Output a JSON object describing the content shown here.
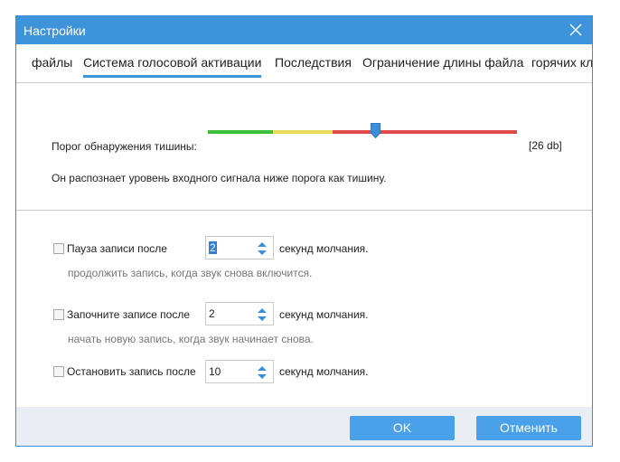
{
  "window": {
    "title": "Настройки"
  },
  "tabs": [
    {
      "label": "файлы"
    },
    {
      "label": "Система голосовой активации"
    },
    {
      "label": "Последствия"
    },
    {
      "label": "Ограничение длины файла"
    },
    {
      "label": "горячих кл"
    }
  ],
  "silence": {
    "label": "Порог обнаружения тишины:",
    "value_text": "[26 db]",
    "description": "Он распознает уровень входного сигнала ниже порога как тишину."
  },
  "options": [
    {
      "label": "Пауза записи после",
      "value": "2",
      "suffix": "секунд молчания.",
      "hint": "продолжить запись, когда звук снова включится."
    },
    {
      "label": "Започните записе после",
      "value": "2",
      "suffix": "секунд молчания.",
      "hint": "начать новую запись, когда звук начинает снова."
    },
    {
      "label": "Остановить запись после",
      "value": "10",
      "suffix": "секунд молчания."
    }
  ],
  "footer": {
    "ok": "OK",
    "cancel": "Отменить"
  },
  "colors": {
    "accent": "#3d94db",
    "green": "#3cc03c",
    "yellow": "#e8dc5a",
    "red": "#e14a4a"
  }
}
